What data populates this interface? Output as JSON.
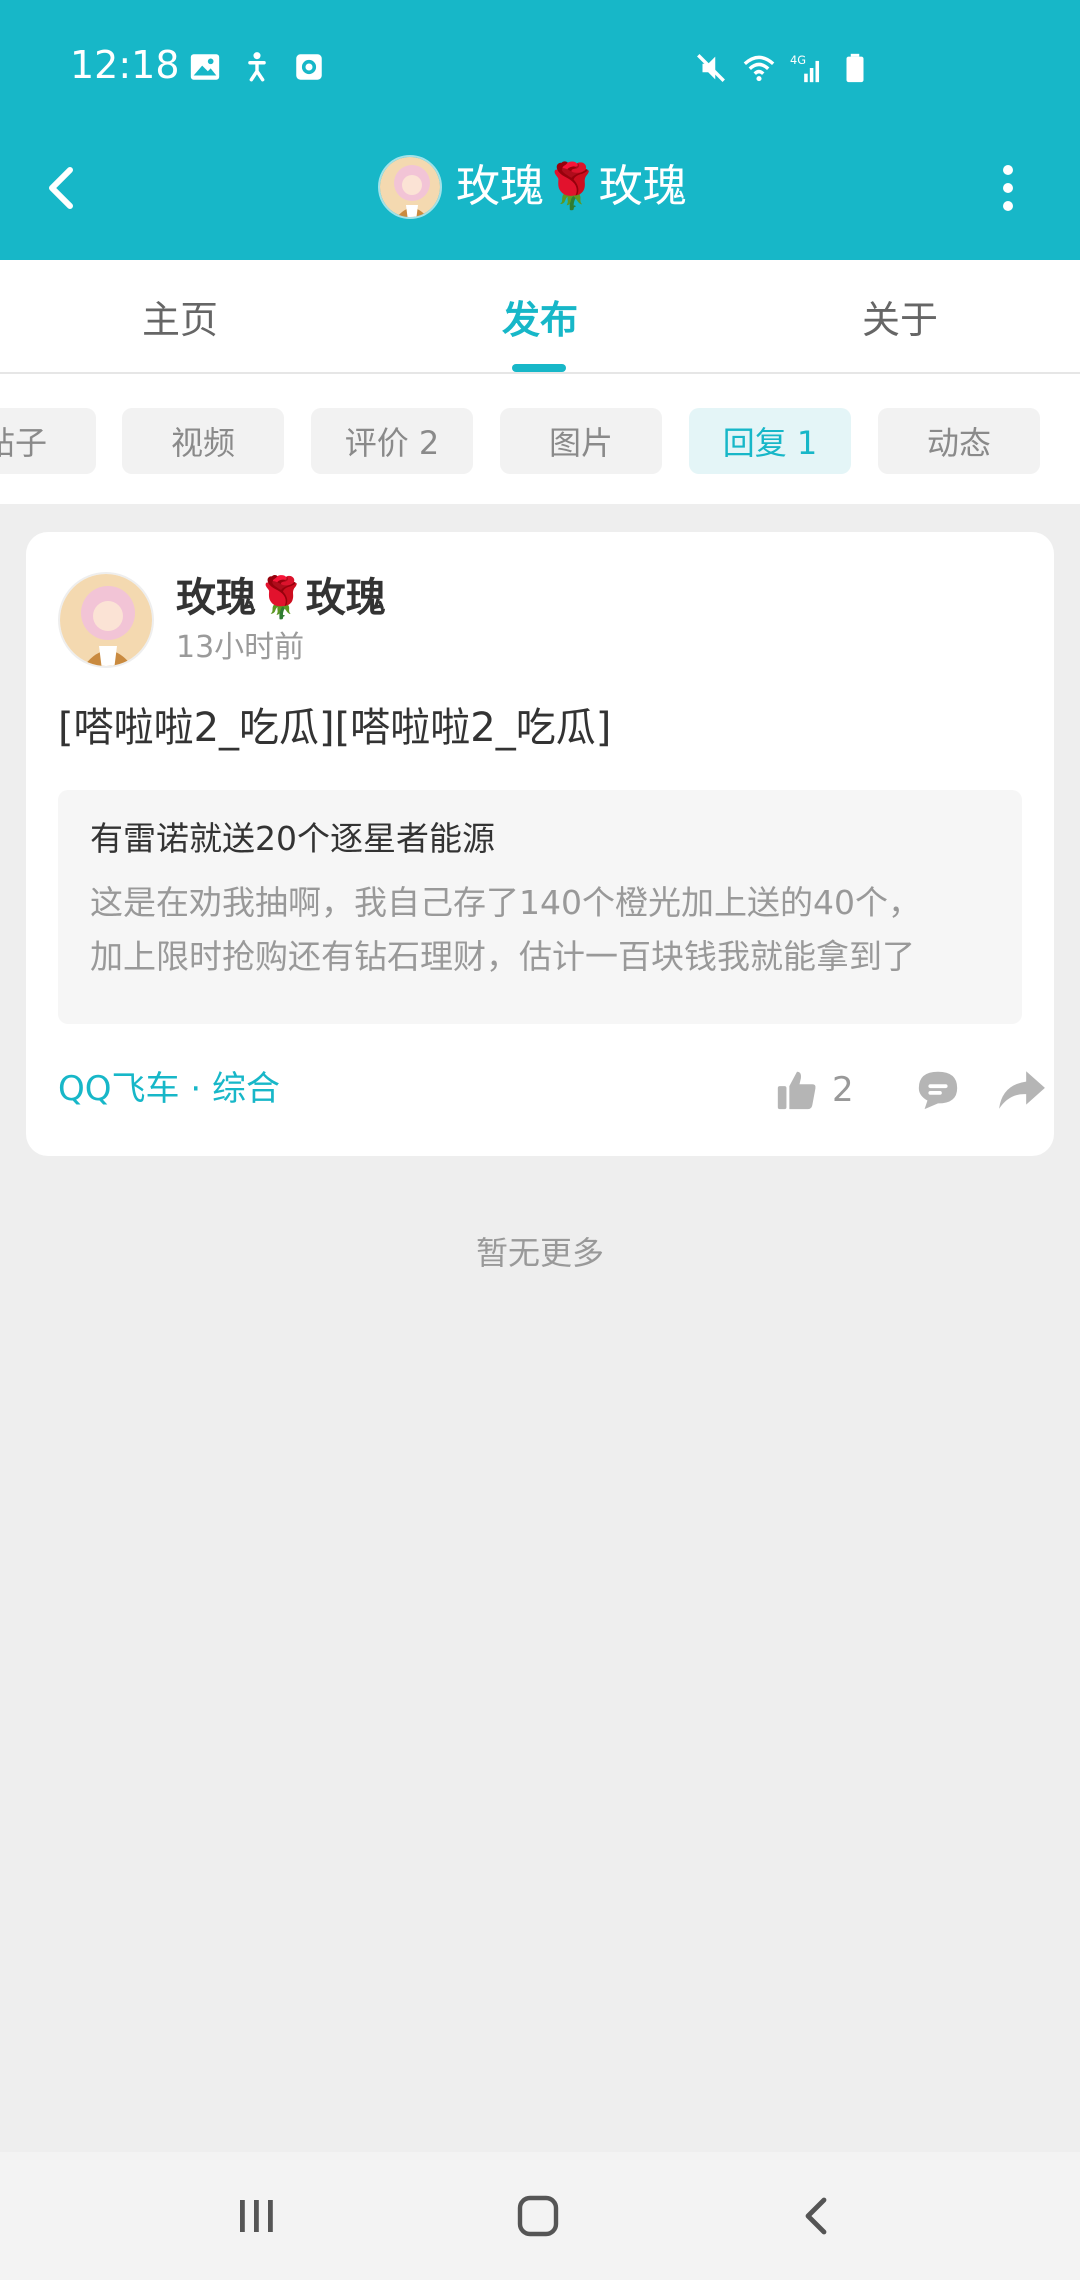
{
  "status_bar": {
    "time": "12:18",
    "left_icons": [
      "image-icon",
      "accessibility-icon",
      "recorder-icon"
    ],
    "right_icons": [
      "mute-icon",
      "wifi-icon",
      "signal-4g-icon",
      "battery-icon"
    ]
  },
  "header": {
    "title": "玫瑰🌹玫瑰",
    "back_icon": "chevron-left-icon",
    "more_icon": "more-vertical-icon"
  },
  "tabs": [
    {
      "label": "主页",
      "active": false
    },
    {
      "label": "发布",
      "active": true
    },
    {
      "label": "关于",
      "active": false
    }
  ],
  "filters": [
    {
      "label": "帖子",
      "active": false
    },
    {
      "label": "视频",
      "active": false
    },
    {
      "label": "评价 2",
      "active": false
    },
    {
      "label": "图片",
      "active": false
    },
    {
      "label": "回复 1",
      "active": true
    },
    {
      "label": "动态",
      "active": false
    }
  ],
  "post": {
    "author": "玫瑰🌹玫瑰",
    "time": "13小时前",
    "content": "[嗒啦啦2_吃瓜][嗒啦啦2_吃瓜]",
    "quote": {
      "title": "有雷诺就送20个逐星者能源",
      "body_line1": "这是在劝我抽啊，我自己存了140个橙光加上送的40个，",
      "body_line2": "加上限时抢购还有钻石理财，估计一百块钱我就能拿到了"
    },
    "forum": "QQ飞车 · 综合",
    "likes": "2"
  },
  "footer_text": "暂无更多",
  "nav_bar": {
    "recents_icon": "recents-icon",
    "home_icon": "home-icon",
    "back_icon": "back-icon"
  },
  "colors": {
    "accent": "#17b7c8",
    "background": "#eeeeee",
    "card": "#ffffff"
  }
}
